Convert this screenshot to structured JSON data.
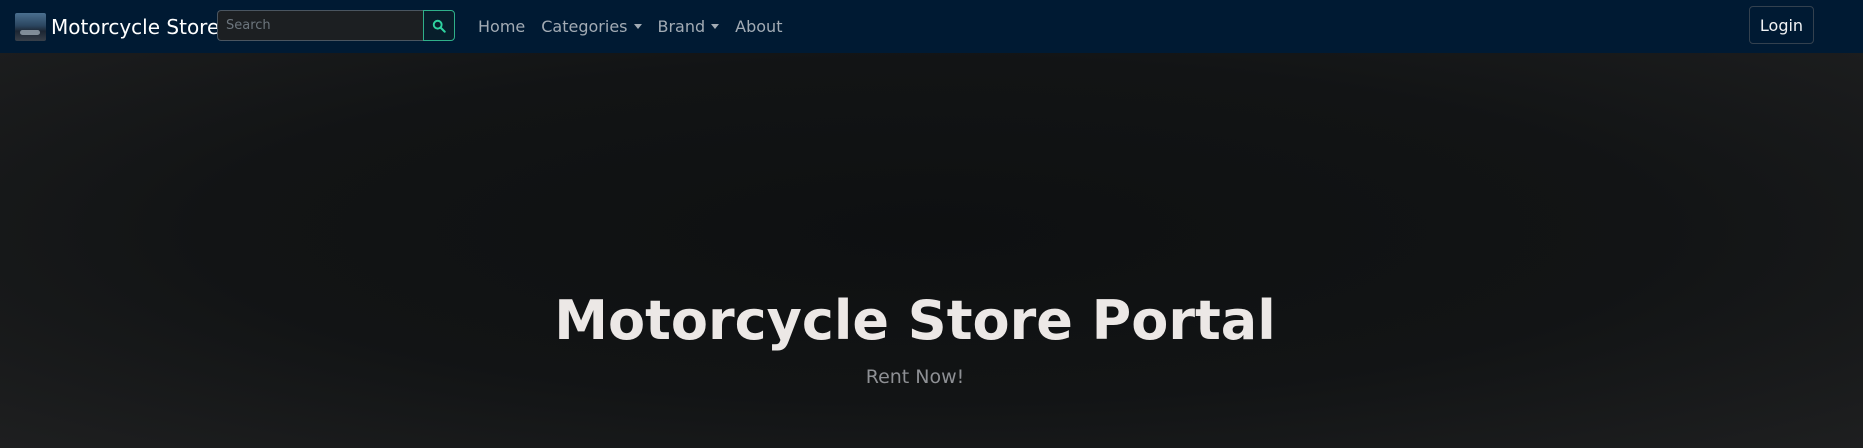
{
  "navbar": {
    "brand": {
      "logo_icon": "motorcycle-photo-icon",
      "title": "Motorcycle Store"
    },
    "search": {
      "placeholder": "Search",
      "value": "",
      "button_icon": "search-icon"
    },
    "nav_items": [
      {
        "label": "Home",
        "has_dropdown": false
      },
      {
        "label": "Categories",
        "has_dropdown": true
      },
      {
        "label": "Brand",
        "has_dropdown": true
      },
      {
        "label": "About",
        "has_dropdown": false
      }
    ],
    "login_label": "Login"
  },
  "hero": {
    "title": "Motorcycle Store Portal",
    "subtitle": "Rent Now!"
  },
  "colors": {
    "navbar_bg": "#001a33",
    "page_bg": "#121416",
    "search_accent": "#2fb08a",
    "nav_text": "#a2abb4",
    "hero_title": "#ece8e6",
    "hero_subtitle": "#8e9094"
  }
}
